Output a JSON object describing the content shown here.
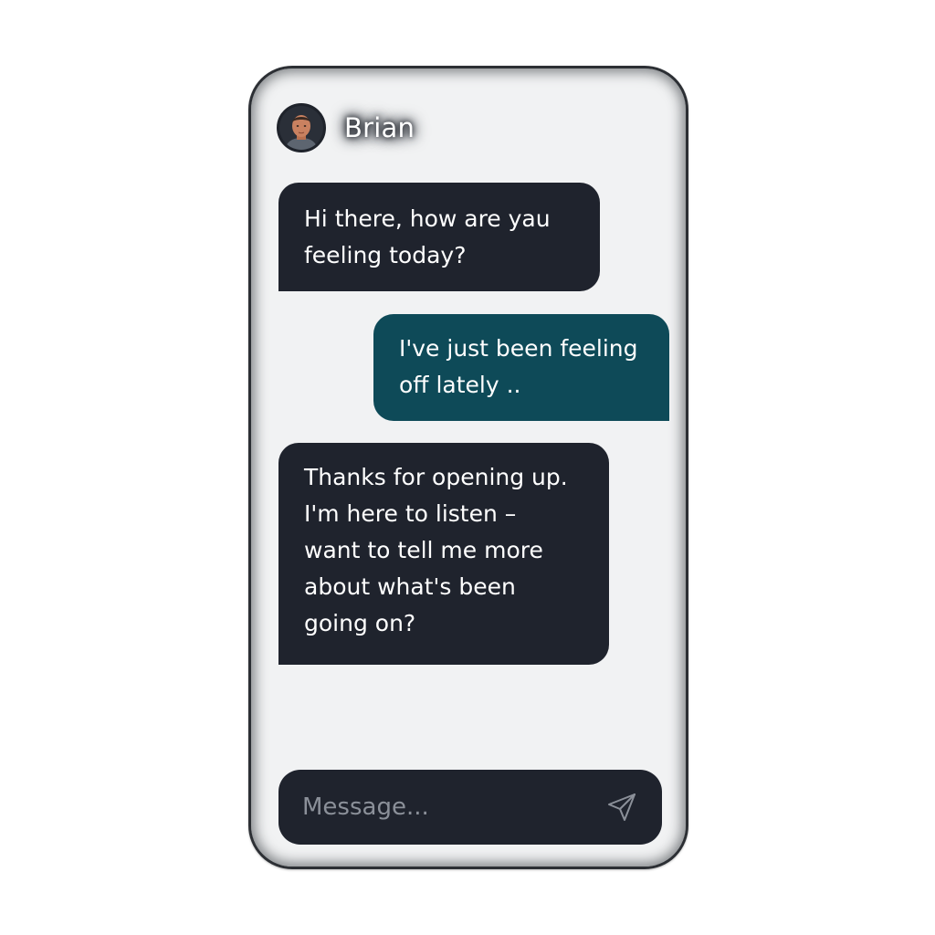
{
  "contact": {
    "name": "Brian",
    "avatar_icon": "user-avatar-photo"
  },
  "messages": [
    {
      "direction": "incoming",
      "text": "Hi there, how are yau\nfeeling today?"
    },
    {
      "direction": "outgoing",
      "text": "I've just been feeling\noff lately .."
    },
    {
      "direction": "incoming",
      "text": "Thanks for opening up.\nI'm here to listen –\nwant to tell me more\nabout what's been\ngoing on?"
    }
  ],
  "composer": {
    "placeholder": "Message...",
    "value": "",
    "send_icon": "send-icon"
  },
  "colors": {
    "incoming_bubble": "#1f232d",
    "outgoing_bubble": "#0e4a58",
    "screen_background": "#f1f2f3",
    "text": "#ffffff",
    "placeholder": "#8b9099"
  }
}
